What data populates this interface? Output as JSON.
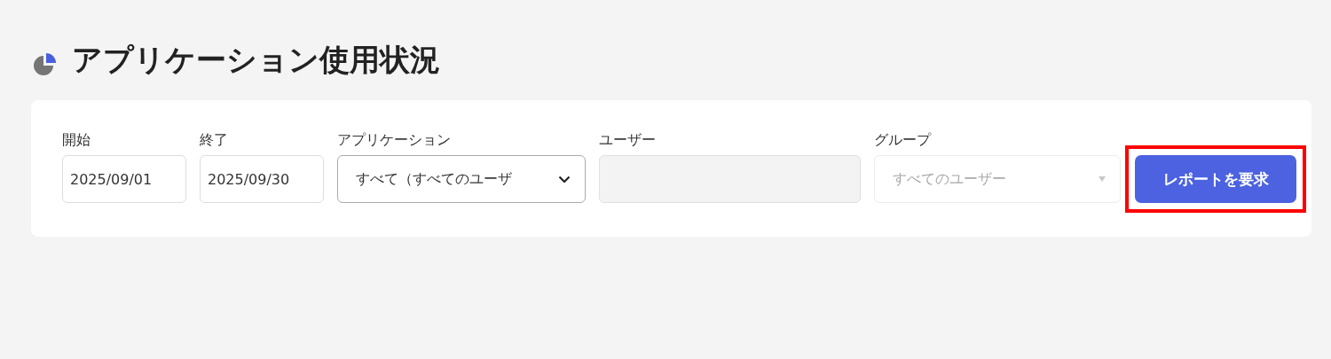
{
  "page": {
    "title": "アプリケーション使用状況"
  },
  "filters": [
    {
      "kind": "date",
      "label": "開始",
      "value": "2025/09/01",
      "disabled": false
    },
    {
      "kind": "date",
      "label": "終了",
      "value": "2025/09/30",
      "disabled": false
    },
    {
      "kind": "select",
      "label": "アプリケーション",
      "value": "すべて（すべてのユーザ",
      "disabled": false
    },
    {
      "kind": "text",
      "label": "ユーザー",
      "disabled": true
    },
    {
      "kind": "select",
      "label": "グループ",
      "value": "すべてのユーザー",
      "disabled": true
    }
  ],
  "submit": {
    "label": "レポートを要求",
    "highlighted": true
  }
}
